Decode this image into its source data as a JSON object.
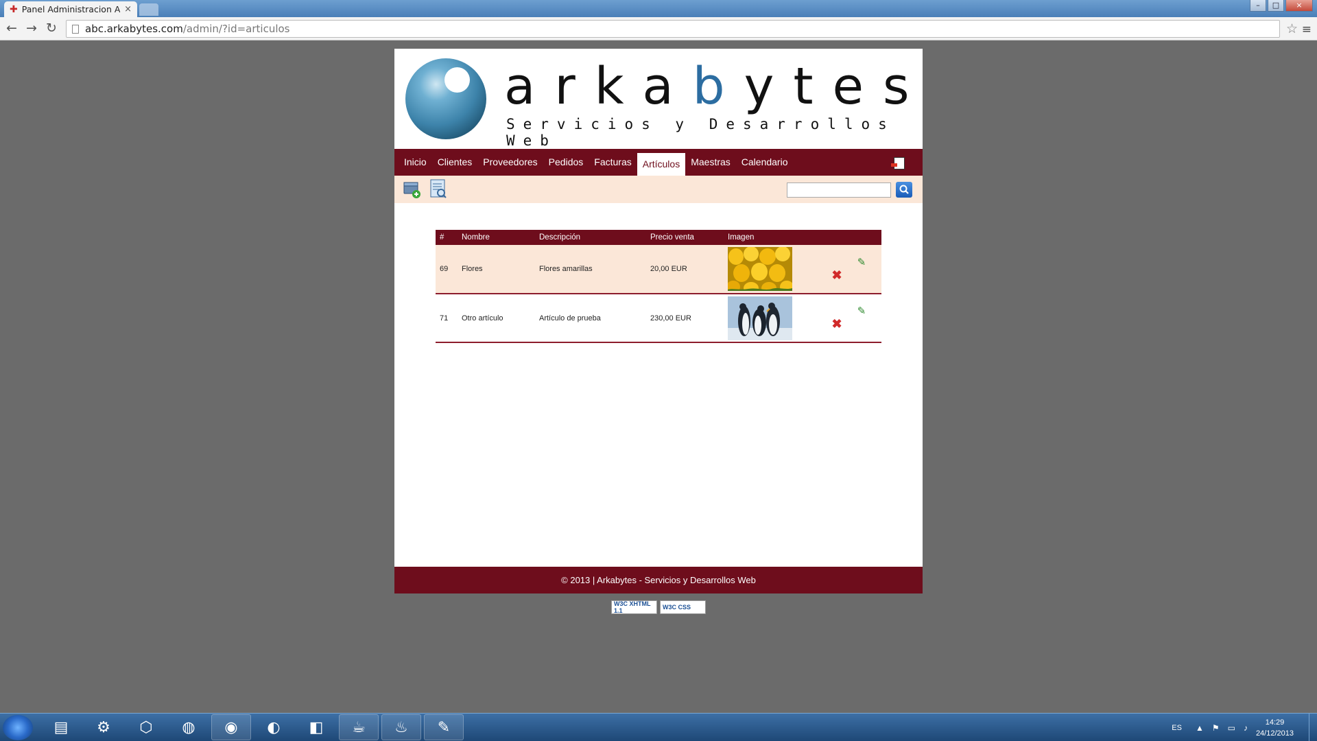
{
  "browser": {
    "tab_title": "Panel Administracion ABC",
    "tab_close": "×",
    "url_host": "abc.arkabytes.com",
    "url_path": "/admin/?id=articulos",
    "back": "←",
    "forward": "→",
    "reload": "↻",
    "star": "☆",
    "menu": "≡",
    "minimize": "–",
    "maximize": "□",
    "close": "×"
  },
  "header": {
    "brand_pre": "arka",
    "brand_b": "b",
    "brand_post": "ytes",
    "slogan": "Servicios y Desarrollos Web"
  },
  "nav": {
    "items": [
      "Inicio",
      "Clientes",
      "Proveedores",
      "Pedidos",
      "Facturas",
      "Artículos",
      "Maestras",
      "Calendario"
    ],
    "active": "Artículos"
  },
  "search": {
    "value": ""
  },
  "table": {
    "headers": [
      "#",
      "Nombre",
      "Descripción",
      "Precio venta",
      "Imagen"
    ],
    "rows": [
      {
        "id": "69",
        "name": "Flores",
        "description": "Flores amarillas",
        "price": "20,00 EUR",
        "image": "yellow-tulips"
      },
      {
        "id": "71",
        "name": "Otro artículo",
        "description": "Artículo de prueba",
        "price": "230,00 EUR",
        "image": "penguins"
      }
    ]
  },
  "footer": {
    "text": "© 2013 | Arkabytes - Servicios y Desarrollos Web"
  },
  "badges": [
    "W3C XHTML 1.1",
    "W3C CSS"
  ],
  "taskbar": {
    "apps": [
      "file-explorer-icon",
      "network-icon",
      "virtualbox-icon",
      "firefox-icon",
      "chrome-icon",
      "eclipse-icon",
      "cube-icon",
      "java-ee-icon",
      "steam-icon",
      "gimp-icon"
    ],
    "lang": "ES",
    "time": "14:29",
    "date": "24/12/2013"
  },
  "colors": {
    "brand_dark": "#6e0d1c",
    "sub_bg": "#fbe7d8",
    "accent_blue": "#2c6da1"
  }
}
